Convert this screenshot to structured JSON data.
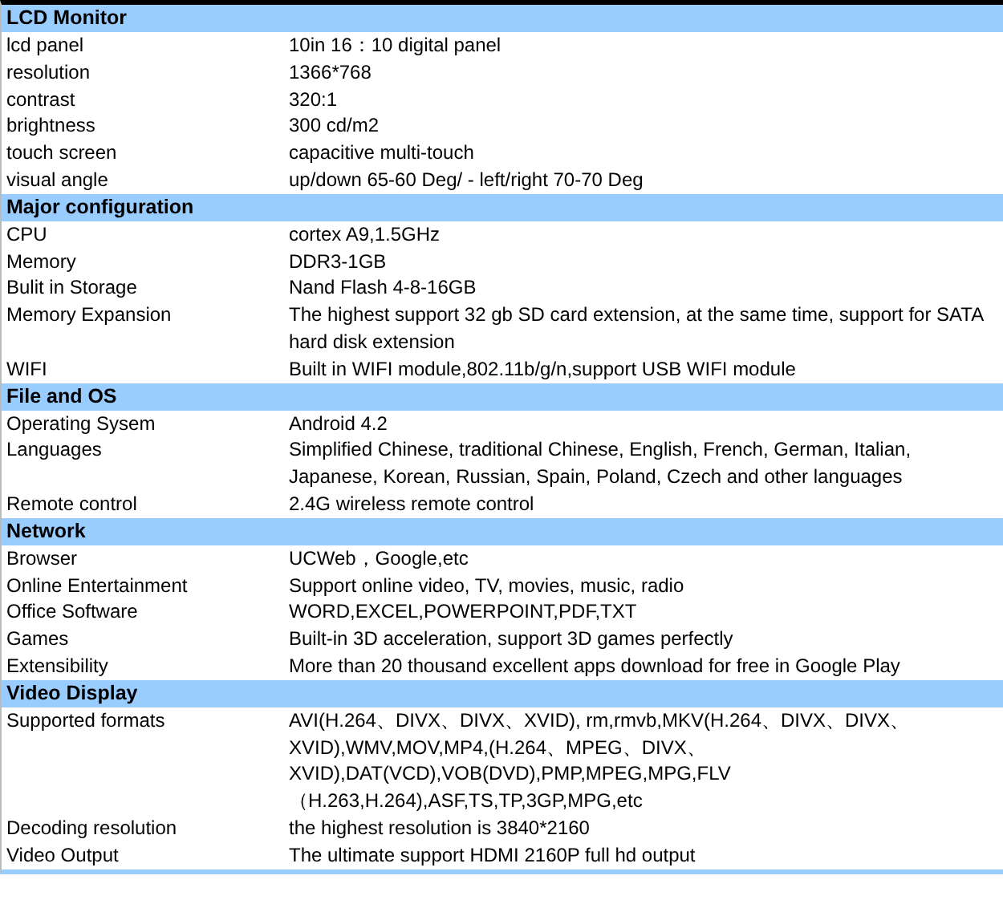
{
  "sections": [
    {
      "title": "LCD Monitor",
      "rows": [
        {
          "label": "lcd panel",
          "value": "10in 16：10  digital panel"
        },
        {
          "label": "resolution",
          "value": "1366*768"
        },
        {
          "label": "contrast",
          "value": "320:1"
        },
        {
          "label": "brightness",
          "value": "300 cd/m2"
        },
        {
          "label": "touch screen",
          "value": "capacitive multi-touch"
        },
        {
          "label": "visual angle",
          "value": "up/down 65-60 Deg/ - left/right 70-70 Deg"
        }
      ]
    },
    {
      "title": "Major configuration",
      "rows": [
        {
          "label": "CPU",
          "value": " cortex A9,1.5GHz"
        },
        {
          "label": "Memory",
          "value": "DDR3-1GB"
        },
        {
          "label": "Bulit in Storage",
          "value": "Nand Flash 4-8-16GB"
        },
        {
          "label": "Memory Expansion",
          "value": "The highest support 32 gb SD card extension, at the same time, support for SATA hard disk extension"
        },
        {
          "label": "WIFI",
          "value": "Built in WIFI module,802.11b/g/n,support USB WIFI module"
        }
      ]
    },
    {
      "title": "File and OS",
      "rows": [
        {
          "label": "Operating Sysem",
          "value": "Android 4.2"
        },
        {
          "label": "Languages",
          "value": "Simplified Chinese, traditional Chinese, English, French, German, Italian, Japanese, Korean, Russian, Spain, Poland, Czech and other languages"
        },
        {
          "label": "Remote control",
          "value": "2.4G wireless remote control"
        }
      ]
    },
    {
      "title": "Network",
      "rows": [
        {
          "label": "Browser",
          "value": "UCWeb，Google,etc"
        },
        {
          "label": "Online Entertainment",
          "value": "Support online video, TV, movies, music, radio"
        },
        {
          "label": "Office Software",
          "value": "WORD,EXCEL,POWERPOINT,PDF,TXT"
        },
        {
          "label": "Games",
          "value": "Built-in 3D acceleration, support 3D games perfectly"
        },
        {
          "label": "Extensibility",
          "value": "More than 20 thousand excellent apps download for free in Google Play"
        }
      ]
    },
    {
      "title": "Video Display",
      "rows": [
        {
          "label": "Supported formats",
          "value": "AVI(H.264、DIVX、DIVX、XVID), rm,rmvb,MKV(H.264、DIVX、DIVX、XVID),WMV,MOV,MP4,(H.264、MPEG、DIVX、XVID),DAT(VCD),VOB(DVD),PMP,MPEG,MPG,FLV（H.263,H.264),ASF,TS,TP,3GP,MPG,etc"
        },
        {
          "label": "Decoding resolution",
          "value": "the highest resolution is 3840*2160"
        },
        {
          "label": "Video Output",
          "value": "The ultimate support HDMI 2160P full hd output"
        }
      ]
    }
  ]
}
